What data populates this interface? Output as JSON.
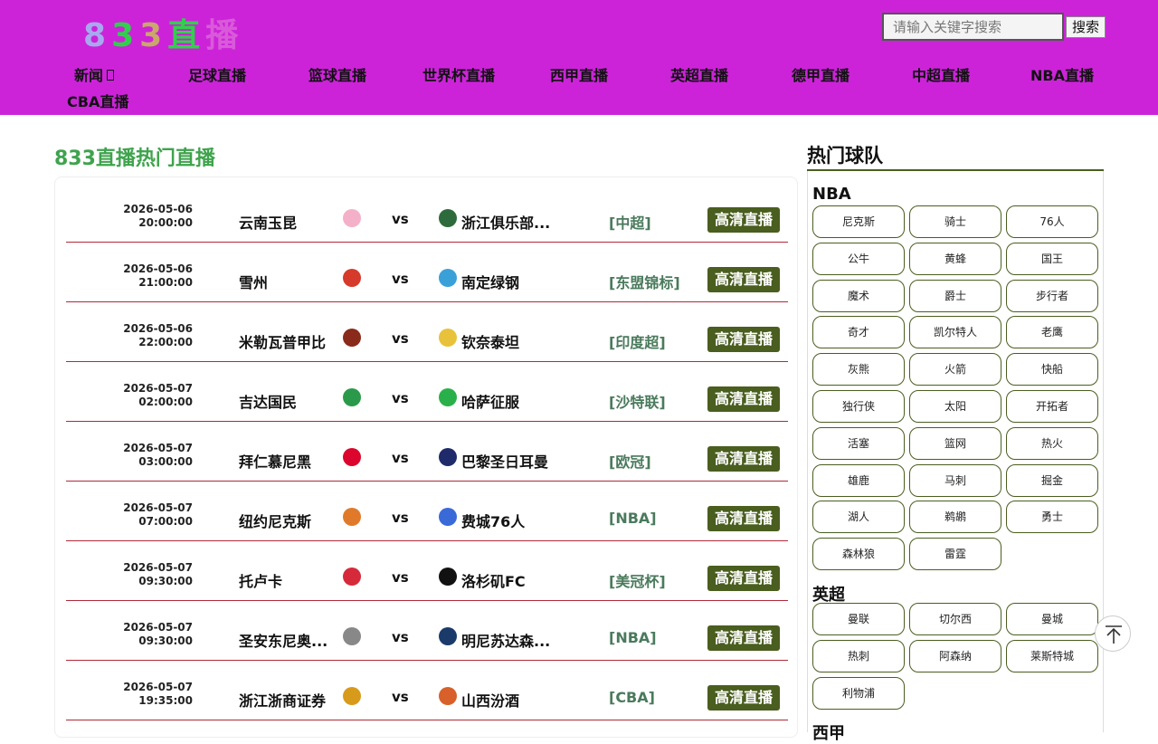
{
  "logo": {
    "chars": [
      {
        "t": "8",
        "color": "#a8a8f0"
      },
      {
        "t": "3",
        "color": "#2fd14a"
      },
      {
        "t": "3",
        "color": "#c9a86a"
      },
      {
        "t": "直",
        "color": "#2fd14a"
      },
      {
        "t": "播",
        "color": "#d95ad9"
      }
    ]
  },
  "search": {
    "placeholder": "请输入关键字搜索",
    "button": "搜索"
  },
  "nav": [
    "新闻",
    "足球直播",
    "篮球直播",
    "世界杯直播",
    "西甲直播",
    "英超直播",
    "德甲直播",
    "中超直播",
    "NBA直播",
    "CBA直播"
  ],
  "main": {
    "title": "833直播热门直播",
    "vs": "vs",
    "button": "高清直播"
  },
  "matches": [
    {
      "date": "2026-05-06",
      "time": "20:00:00",
      "home": "云南玉昆",
      "away": "浙江俱乐部...",
      "league": "[中超]",
      "home_color": "#f4b0c8",
      "away_color": "#2e6b3c"
    },
    {
      "date": "2026-05-06",
      "time": "21:00:00",
      "home": "雪州",
      "away": "南定绿钢",
      "league": "[东盟锦标]",
      "home_color": "#d63a2a",
      "away_color": "#3aa0d8"
    },
    {
      "date": "2026-05-06",
      "time": "22:00:00",
      "home": "米勒瓦普甲比",
      "away": "钦奈泰坦",
      "league": "[印度超]",
      "home_color": "#8a2a1a",
      "away_color": "#e8c23a"
    },
    {
      "date": "2026-05-07",
      "time": "02:00:00",
      "home": "吉达国民",
      "away": "哈萨征服",
      "league": "[沙特联]",
      "home_color": "#2a9a4a",
      "away_color": "#2ab04a"
    },
    {
      "date": "2026-05-07",
      "time": "03:00:00",
      "home": "拜仁慕尼黑",
      "away": "巴黎圣日耳曼",
      "league": "[欧冠]",
      "home_color": "#dc052d",
      "away_color": "#1e2a6a"
    },
    {
      "date": "2026-05-07",
      "time": "07:00:00",
      "home": "纽约尼克斯",
      "away": "费城76人",
      "league": "[NBA]",
      "home_color": "#e07a2a",
      "away_color": "#3a6ad8"
    },
    {
      "date": "2026-05-07",
      "time": "09:30:00",
      "home": "托卢卡",
      "away": "洛杉矶FC",
      "league": "[美冠杯]",
      "home_color": "#d62a3a",
      "away_color": "#111111"
    },
    {
      "date": "2026-05-07",
      "time": "09:30:00",
      "home": "圣安东尼奥...",
      "away": "明尼苏达森...",
      "league": "[NBA]",
      "home_color": "#888888",
      "away_color": "#1a3a6a"
    },
    {
      "date": "2026-05-07",
      "time": "19:35:00",
      "home": "浙江浙商证券",
      "away": "山西汾酒",
      "league": "[CBA]",
      "home_color": "#d89a1a",
      "away_color": "#d8602a"
    }
  ],
  "sidebar": {
    "title": "热门球队",
    "groups": [
      {
        "name": "NBA",
        "teams": [
          "尼克斯",
          "骑士",
          "76人",
          "公牛",
          "黄蜂",
          "国王",
          "魔术",
          "爵士",
          "步行者",
          "奇才",
          "凯尔特人",
          "老鹰",
          "灰熊",
          "火箭",
          "快船",
          "独行侠",
          "太阳",
          "开拓者",
          "活塞",
          "篮网",
          "热火",
          "雄鹿",
          "马刺",
          "掘金",
          "湖人",
          "鹈鹕",
          "勇士",
          "森林狼",
          "雷霆"
        ]
      },
      {
        "name": "英超",
        "teams": [
          "曼联",
          "切尔西",
          "曼城",
          "热刺",
          "阿森纳",
          "莱斯特城",
          "利物浦"
        ]
      },
      {
        "name": "西甲",
        "teams": []
      }
    ]
  }
}
